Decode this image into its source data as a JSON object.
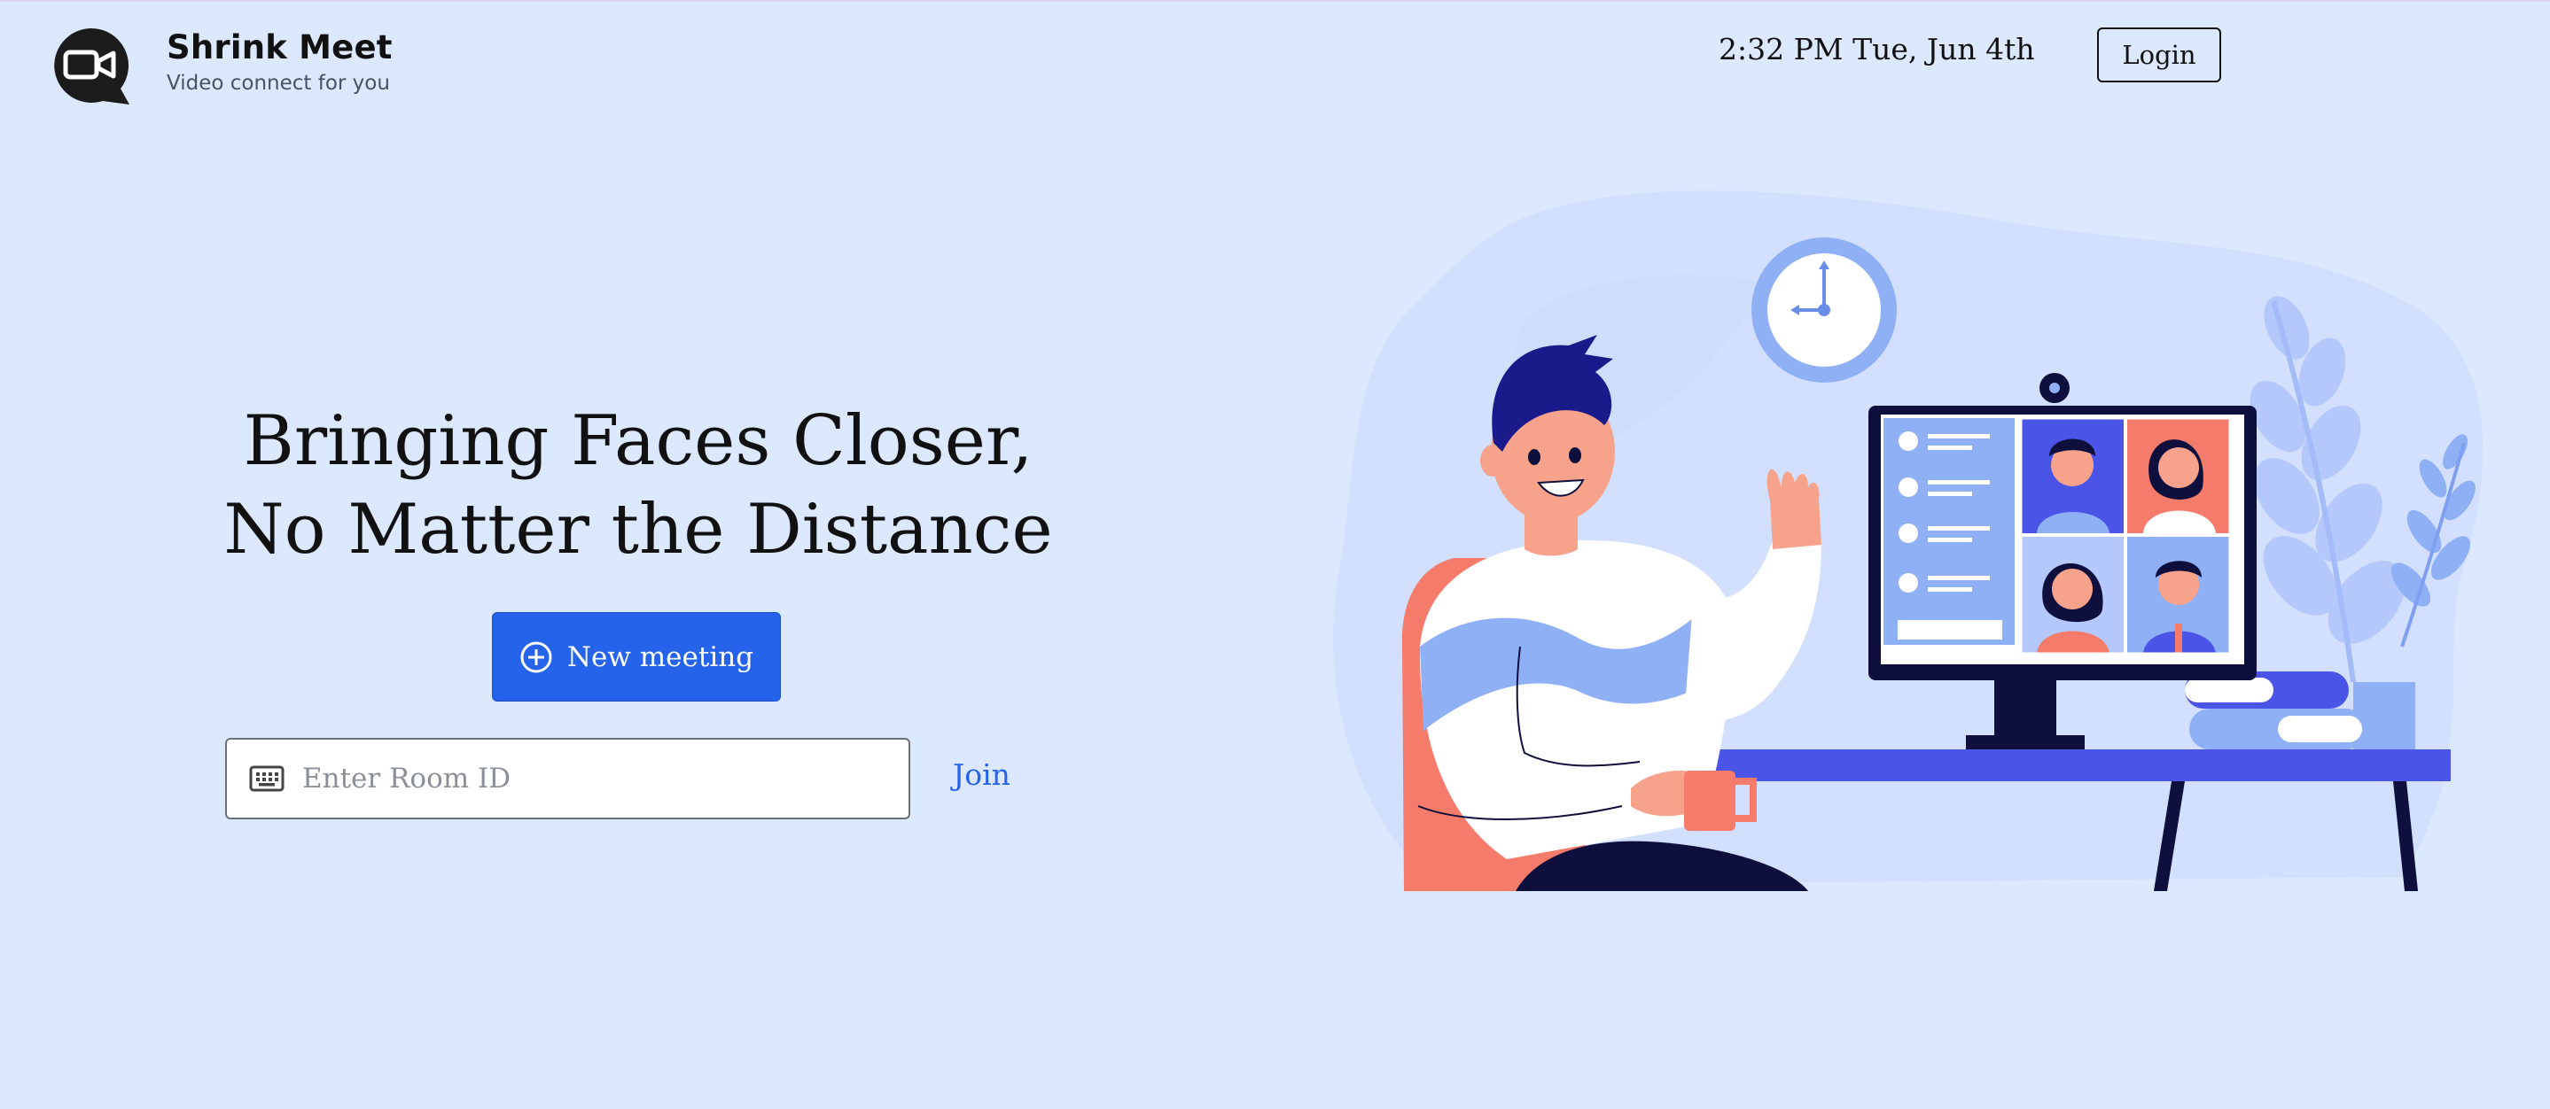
{
  "brand": {
    "title": "Shrink Meet",
    "subtitle": "Video connect for you",
    "logo_icon": "video-camera-icon"
  },
  "header": {
    "datetime": "2:32 PM Tue, Jun 4th",
    "login_label": "Login"
  },
  "hero": {
    "title_line1": "Bringing Faces Closer,",
    "title_line2": "No Matter the Distance",
    "new_meeting_label": "New meeting",
    "new_meeting_icon": "plus-circle-icon",
    "room_input_placeholder": "Enter Room ID",
    "room_input_value": "",
    "keyboard_icon": "keyboard-icon",
    "join_label": "Join"
  },
  "colors": {
    "background": "#dbe8fe",
    "primary": "#2563eb",
    "accent_coral": "#f57b6b",
    "accent_navy": "#0f0f3d",
    "accent_periwinkle": "#8fb0f5"
  }
}
